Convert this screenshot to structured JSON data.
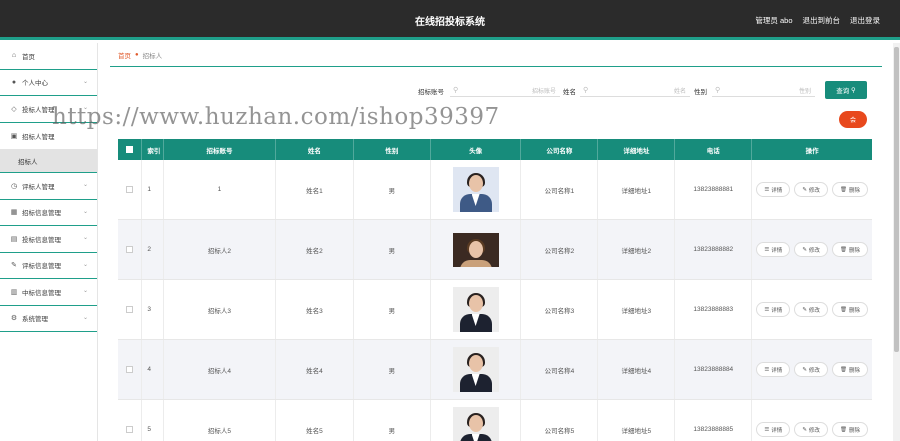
{
  "header": {
    "title": "在线招投标系统",
    "user_label": "管理员 abo",
    "front_link": "退出到前台",
    "logout": "退出登录"
  },
  "sidebar": {
    "items": [
      {
        "label": "首页",
        "icon": "home-icon"
      },
      {
        "label": "个人中心",
        "icon": "user-icon"
      },
      {
        "label": "投标人管理",
        "icon": "tag-icon"
      },
      {
        "label": "招标人管理",
        "icon": "building-icon"
      },
      {
        "label": "招标人",
        "icon": ""
      },
      {
        "label": "评标人管理",
        "icon": "clock-icon"
      },
      {
        "label": "招标信息管理",
        "icon": "grid-icon"
      },
      {
        "label": "投标信息管理",
        "icon": "list-icon"
      },
      {
        "label": "评标信息管理",
        "icon": "pen-icon"
      },
      {
        "label": "中标信息管理",
        "icon": "box-icon"
      },
      {
        "label": "系统管理",
        "icon": "gear-icon"
      }
    ]
  },
  "breadcrumb": {
    "home": "首页",
    "current": "招标人"
  },
  "search": {
    "account_label": "招标账号",
    "account_placeholder": "招标账号",
    "name_label": "姓名",
    "name_placeholder": "姓名",
    "sex_label": "性别",
    "sex_placeholder": "性别",
    "button": "查询"
  },
  "delete_button": "会",
  "table": {
    "headers": [
      "索引",
      "招标账号",
      "姓名",
      "性别",
      "头像",
      "公司名称",
      "详细地址",
      "电话",
      "操作"
    ],
    "rows": [
      {
        "idx": "1",
        "account": "1",
        "name": "姓名1",
        "sex": "男",
        "company": "公司名称1",
        "address": "详细地址1",
        "phone": "13823888881"
      },
      {
        "idx": "2",
        "account": "招标人2",
        "name": "姓名2",
        "sex": "男",
        "company": "公司名称2",
        "address": "详细地址2",
        "phone": "13823888882"
      },
      {
        "idx": "3",
        "account": "招标人3",
        "name": "姓名3",
        "sex": "男",
        "company": "公司名称3",
        "address": "详细地址3",
        "phone": "13823888883"
      },
      {
        "idx": "4",
        "account": "招标人4",
        "name": "姓名4",
        "sex": "男",
        "company": "公司名称4",
        "address": "详细地址4",
        "phone": "13823888884"
      },
      {
        "idx": "5",
        "account": "招标人5",
        "name": "姓名5",
        "sex": "男",
        "company": "公司名称5",
        "address": "详细地址5",
        "phone": "13823888885"
      }
    ],
    "actions": {
      "detail": "详情",
      "edit": "修改",
      "delete": "删除"
    }
  },
  "watermark": "https://www.huzhan.com/ishop39397"
}
